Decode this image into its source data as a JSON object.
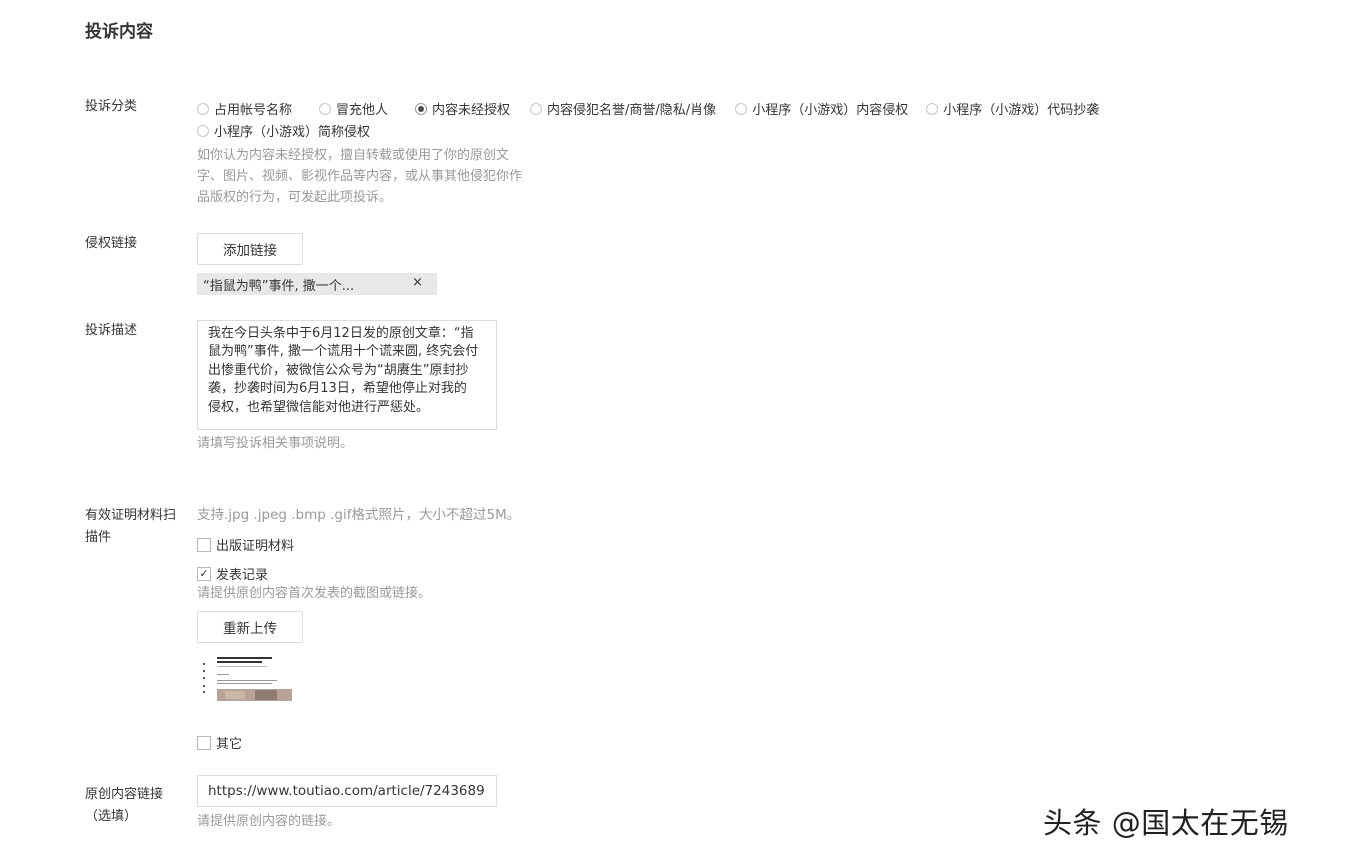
{
  "section_title": "投诉内容",
  "category": {
    "label": "投诉分类",
    "options": [
      {
        "label": "占用帐号名称",
        "checked": false
      },
      {
        "label": "冒充他人",
        "checked": false
      },
      {
        "label": "内容未经授权",
        "checked": true
      },
      {
        "label": "内容侵犯名誉/商誉/隐私/肖像",
        "checked": false
      },
      {
        "label": "小程序（小游戏）内容侵权",
        "checked": false
      },
      {
        "label": "小程序（小游戏）代码抄袭",
        "checked": false
      },
      {
        "label": "小程序（小游戏）简称侵权",
        "checked": false
      }
    ],
    "hint_lines": [
      "如你认为内容未经授权，擅自转载或使用了你的原创文",
      "字、图片、视频、影视作品等内容，或从事其他侵犯你作",
      "品版权的行为，可发起此项投诉。"
    ]
  },
  "infringing_link": {
    "label": "侵权链接",
    "add_button": "添加链接",
    "tag_text": "“指鼠为鸭”事件, 撒一个...",
    "tag_close": "×"
  },
  "description": {
    "label": "投诉描述",
    "lines": [
      "我在今日头条中于6月12日发的原创文章：“指",
      "鼠为鸭”事件, 撒一个谎用十个谎来圆, 终究会付",
      "出惨重代价，被微信公众号为“胡赓生”原封抄",
      "袭，抄袭时间为6月13日，希望他停止对我的",
      "侵权，也希望微信能对他进行严惩处。"
    ],
    "hint": "请填写投诉相关事项说明。"
  },
  "evidence": {
    "label_lines": [
      "有效证明材料扫",
      "描件"
    ],
    "format_hint": "支持.jpg .jpeg .bmp .gif格式照片，大小不超过5M。",
    "checkbox_publish_proof": {
      "label": "出版证明材料",
      "checked": false
    },
    "checkbox_publish_record": {
      "label": "发表记录",
      "checked": true
    },
    "record_hint": "请提供原创内容首次发表的截图或链接。",
    "reupload_button": "重新上传",
    "checkbox_other": {
      "label": "其它",
      "checked": false
    },
    "check_mark": "✓"
  },
  "original_link": {
    "label_lines": [
      "原创内容链接",
      "（选填）"
    ],
    "value": "https://www.toutiao.com/article/7243689",
    "hint": "请提供原创内容的链接。"
  },
  "watermark": "头条 @国太在无锡"
}
